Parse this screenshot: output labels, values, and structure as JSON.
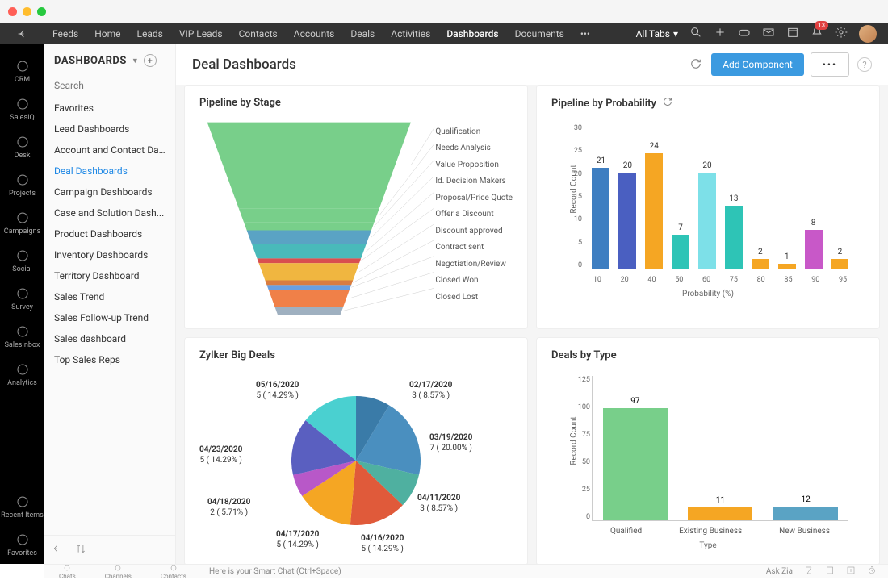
{
  "topnav": {
    "items": [
      "Feeds",
      "Home",
      "Leads",
      "VIP Leads",
      "Contacts",
      "Accounts",
      "Deals",
      "Activities",
      "Dashboards",
      "Documents"
    ],
    "active": "Dashboards",
    "alltabs": "All Tabs",
    "badge": "13"
  },
  "leftrail": {
    "items": [
      "CRM",
      "SalesIQ",
      "Desk",
      "Projects",
      "Campaigns",
      "Social",
      "Survey",
      "SalesInbox",
      "Analytics"
    ],
    "bottom": [
      "Recent Items",
      "Favorites"
    ]
  },
  "sidebar": {
    "title": "DASHBOARDS",
    "search_placeholder": "Search",
    "items": [
      "Favorites",
      "Lead Dashboards",
      "Account and Contact Da...",
      "Deal Dashboards",
      "Campaign Dashboards",
      "Case and Solution Dash...",
      "Product Dashboards",
      "Inventory Dashboards",
      "Territory Dashboard",
      "Sales Trend",
      "Sales Follow-up Trend",
      "Sales dashboard",
      "Top Sales Reps"
    ],
    "active": "Deal Dashboards"
  },
  "main": {
    "title": "Deal Dashboards",
    "add_component": "Add Component",
    "more": "•••"
  },
  "cards": {
    "pipeline_stage": {
      "title": "Pipeline by Stage"
    },
    "pipeline_prob": {
      "title": "Pipeline by Probability"
    },
    "big_deals": {
      "title": "Zylker Big Deals"
    },
    "deals_type": {
      "title": "Deals by Type"
    }
  },
  "bottombar": {
    "segments": [
      "Chats",
      "Channels",
      "Contacts"
    ],
    "chat_hint": "Here is your Smart Chat (Ctrl+Space)",
    "askzia": "Ask Zia"
  },
  "chart_data": [
    {
      "id": "pipeline_stage",
      "type": "funnel",
      "stages": [
        "Qualification",
        "Needs Analysis",
        "Value Proposition",
        "Id. Decision Makers",
        "Proposal/Price Quote",
        "Offer a Discount",
        "Discount approved",
        "Contract sent",
        "Negotiation/Review",
        "Closed Won",
        "Closed Lost"
      ],
      "colors": [
        "#78cf8a",
        "#78cf8a",
        "#78cf8a",
        "#5aa3c4",
        "#49baba",
        "#d94f4f",
        "#f0b640",
        "#d97c40",
        "#6a9fe0",
        "#f08048",
        "#9fb0c0"
      ]
    },
    {
      "id": "pipeline_prob",
      "type": "bar",
      "xlabel": "Probability (%)",
      "ylabel": "Record Count",
      "ylim": [
        0,
        30
      ],
      "yticks": [
        0,
        5,
        10,
        15,
        20,
        25,
        30
      ],
      "categories": [
        "10",
        "20",
        "40",
        "50",
        "60",
        "75",
        "80",
        "85",
        "90",
        "95"
      ],
      "values": [
        21,
        20,
        24,
        7,
        20,
        13,
        2,
        1,
        8,
        2
      ],
      "colors": [
        "#3e7ec1",
        "#4a5fc1",
        "#f5a623",
        "#2ec4b6",
        "#7de0e8",
        "#2ec4b6",
        "#f5a623",
        "#f5a623",
        "#c858c8",
        "#f5a623"
      ]
    },
    {
      "id": "big_deals",
      "type": "pie",
      "series": [
        {
          "label": "02/17/2020",
          "count": 3,
          "pct": 8.57,
          "color": "#3a7ba8"
        },
        {
          "label": "03/19/2020",
          "count": 7,
          "pct": 20.0,
          "color": "#4a8fbf"
        },
        {
          "label": "04/11/2020",
          "count": 3,
          "pct": 8.57,
          "color": "#4fb0a0"
        },
        {
          "label": "04/16/2020",
          "count": 5,
          "pct": 14.29,
          "color": "#e05a3a"
        },
        {
          "label": "04/17/2020",
          "count": 5,
          "pct": 14.29,
          "color": "#f5a623"
        },
        {
          "label": "04/18/2020",
          "count": 2,
          "pct": 5.71,
          "color": "#b858c8"
        },
        {
          "label": "04/23/2020",
          "count": 5,
          "pct": 14.29,
          "color": "#5a5fc0"
        },
        {
          "label": "05/16/2020",
          "count": 5,
          "pct": 14.29,
          "color": "#4ad0d0"
        }
      ]
    },
    {
      "id": "deals_type",
      "type": "bar",
      "xlabel": "Type",
      "ylabel": "Record Count",
      "ylim": [
        0,
        125
      ],
      "yticks": [
        0,
        25,
        50,
        75,
        100,
        125
      ],
      "categories": [
        "Qualified",
        "Existing Business",
        "New Business"
      ],
      "values": [
        97,
        11,
        12
      ],
      "colors": [
        "#78cf8a",
        "#f5a623",
        "#5aa3c4"
      ]
    }
  ]
}
